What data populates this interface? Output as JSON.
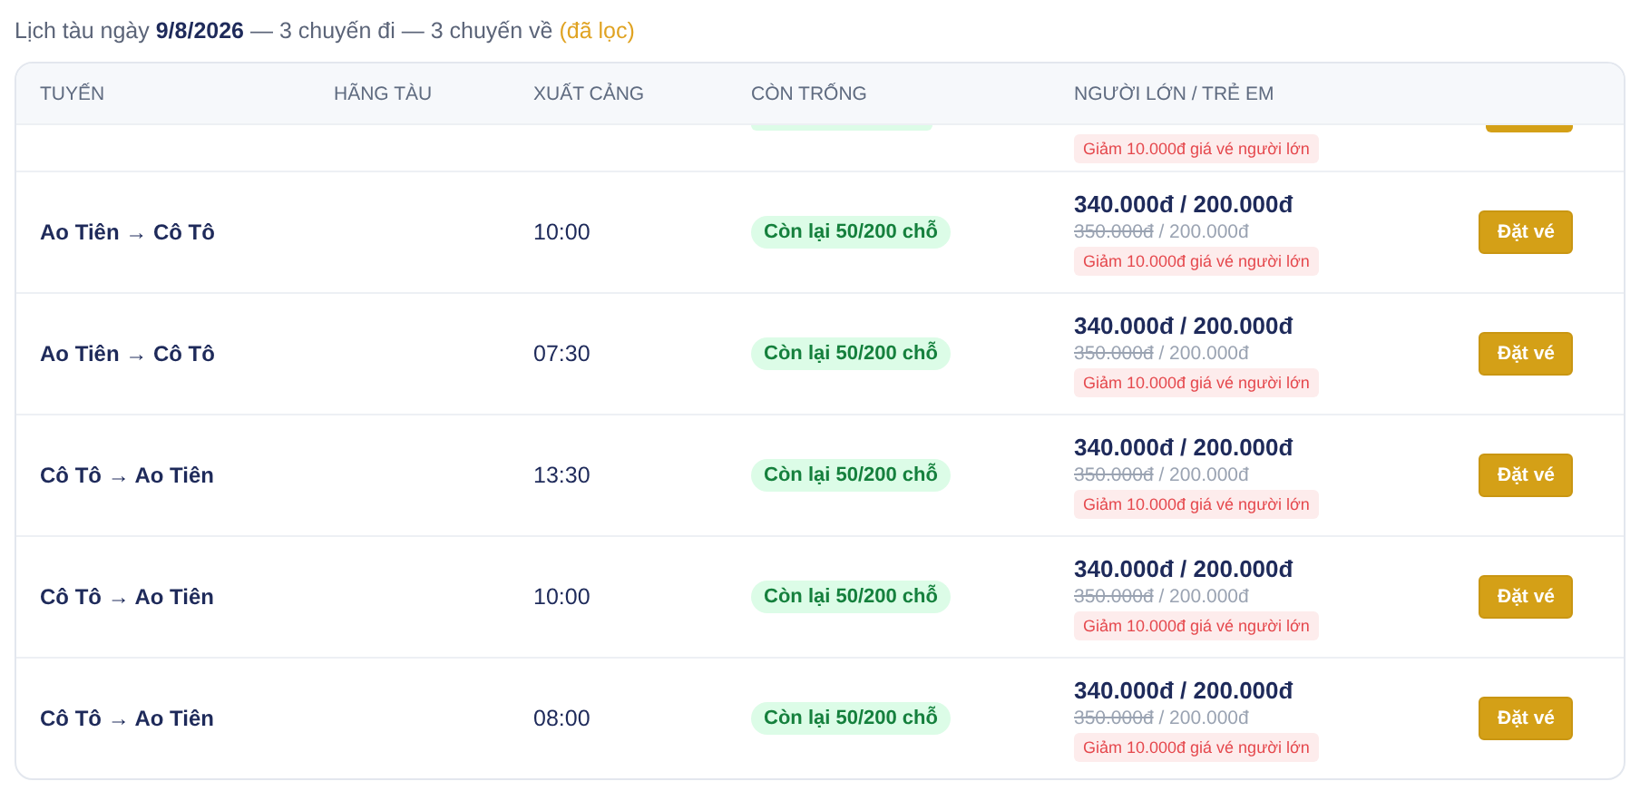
{
  "summary": {
    "prefix": "Lịch tàu ngày",
    "date": "9/8/2026",
    "trips": "— 3 chuyến đi — 3 chuyến về",
    "filter": "(đã lọc)"
  },
  "table": {
    "columns": [
      "TUYẾN",
      "HÃNG TÀU",
      "XUẤT CẢNG",
      "CÒN TRỐNG",
      "NGƯỜI LỚN / TRẺ EM"
    ],
    "partial_row": {
      "discount": "Giảm 10.000đ giá vé người lớn"
    },
    "rows": [
      {
        "route": "Ao Tiên → Cô Tô",
        "departure": "10:00",
        "seats": "Còn lại 50/200 chỗ",
        "price": "340.000đ / 200.000đ",
        "old_adult": "350.000đ",
        "old_child": "/ 200.000đ",
        "discount": "Giảm 10.000đ giá vé người lớn",
        "action": "Đặt vé"
      },
      {
        "route": "Ao Tiên → Cô Tô",
        "departure": "07:30",
        "seats": "Còn lại 50/200 chỗ",
        "price": "340.000đ / 200.000đ",
        "old_adult": "350.000đ",
        "old_child": "/ 200.000đ",
        "discount": "Giảm 10.000đ giá vé người lớn",
        "action": "Đặt vé"
      },
      {
        "route": "Cô Tô → Ao Tiên",
        "departure": "13:30",
        "seats": "Còn lại 50/200 chỗ",
        "price": "340.000đ / 200.000đ",
        "old_adult": "350.000đ",
        "old_child": "/ 200.000đ",
        "discount": "Giảm 10.000đ giá vé người lớn",
        "action": "Đặt vé"
      },
      {
        "route": "Cô Tô → Ao Tiên",
        "departure": "10:00",
        "seats": "Còn lại 50/200 chỗ",
        "price": "340.000đ / 200.000đ",
        "old_adult": "350.000đ",
        "old_child": "/ 200.000đ",
        "discount": "Giảm 10.000đ giá vé người lớn",
        "action": "Đặt vé"
      },
      {
        "route": "Cô Tô → Ao Tiên",
        "departure": "08:00",
        "seats": "Còn lại 50/200 chỗ",
        "price": "340.000đ / 200.000đ",
        "old_adult": "350.000đ",
        "old_child": "/ 200.000đ",
        "discount": "Giảm 10.000đ giá vé người lớn",
        "action": "Đặt vé"
      }
    ]
  }
}
